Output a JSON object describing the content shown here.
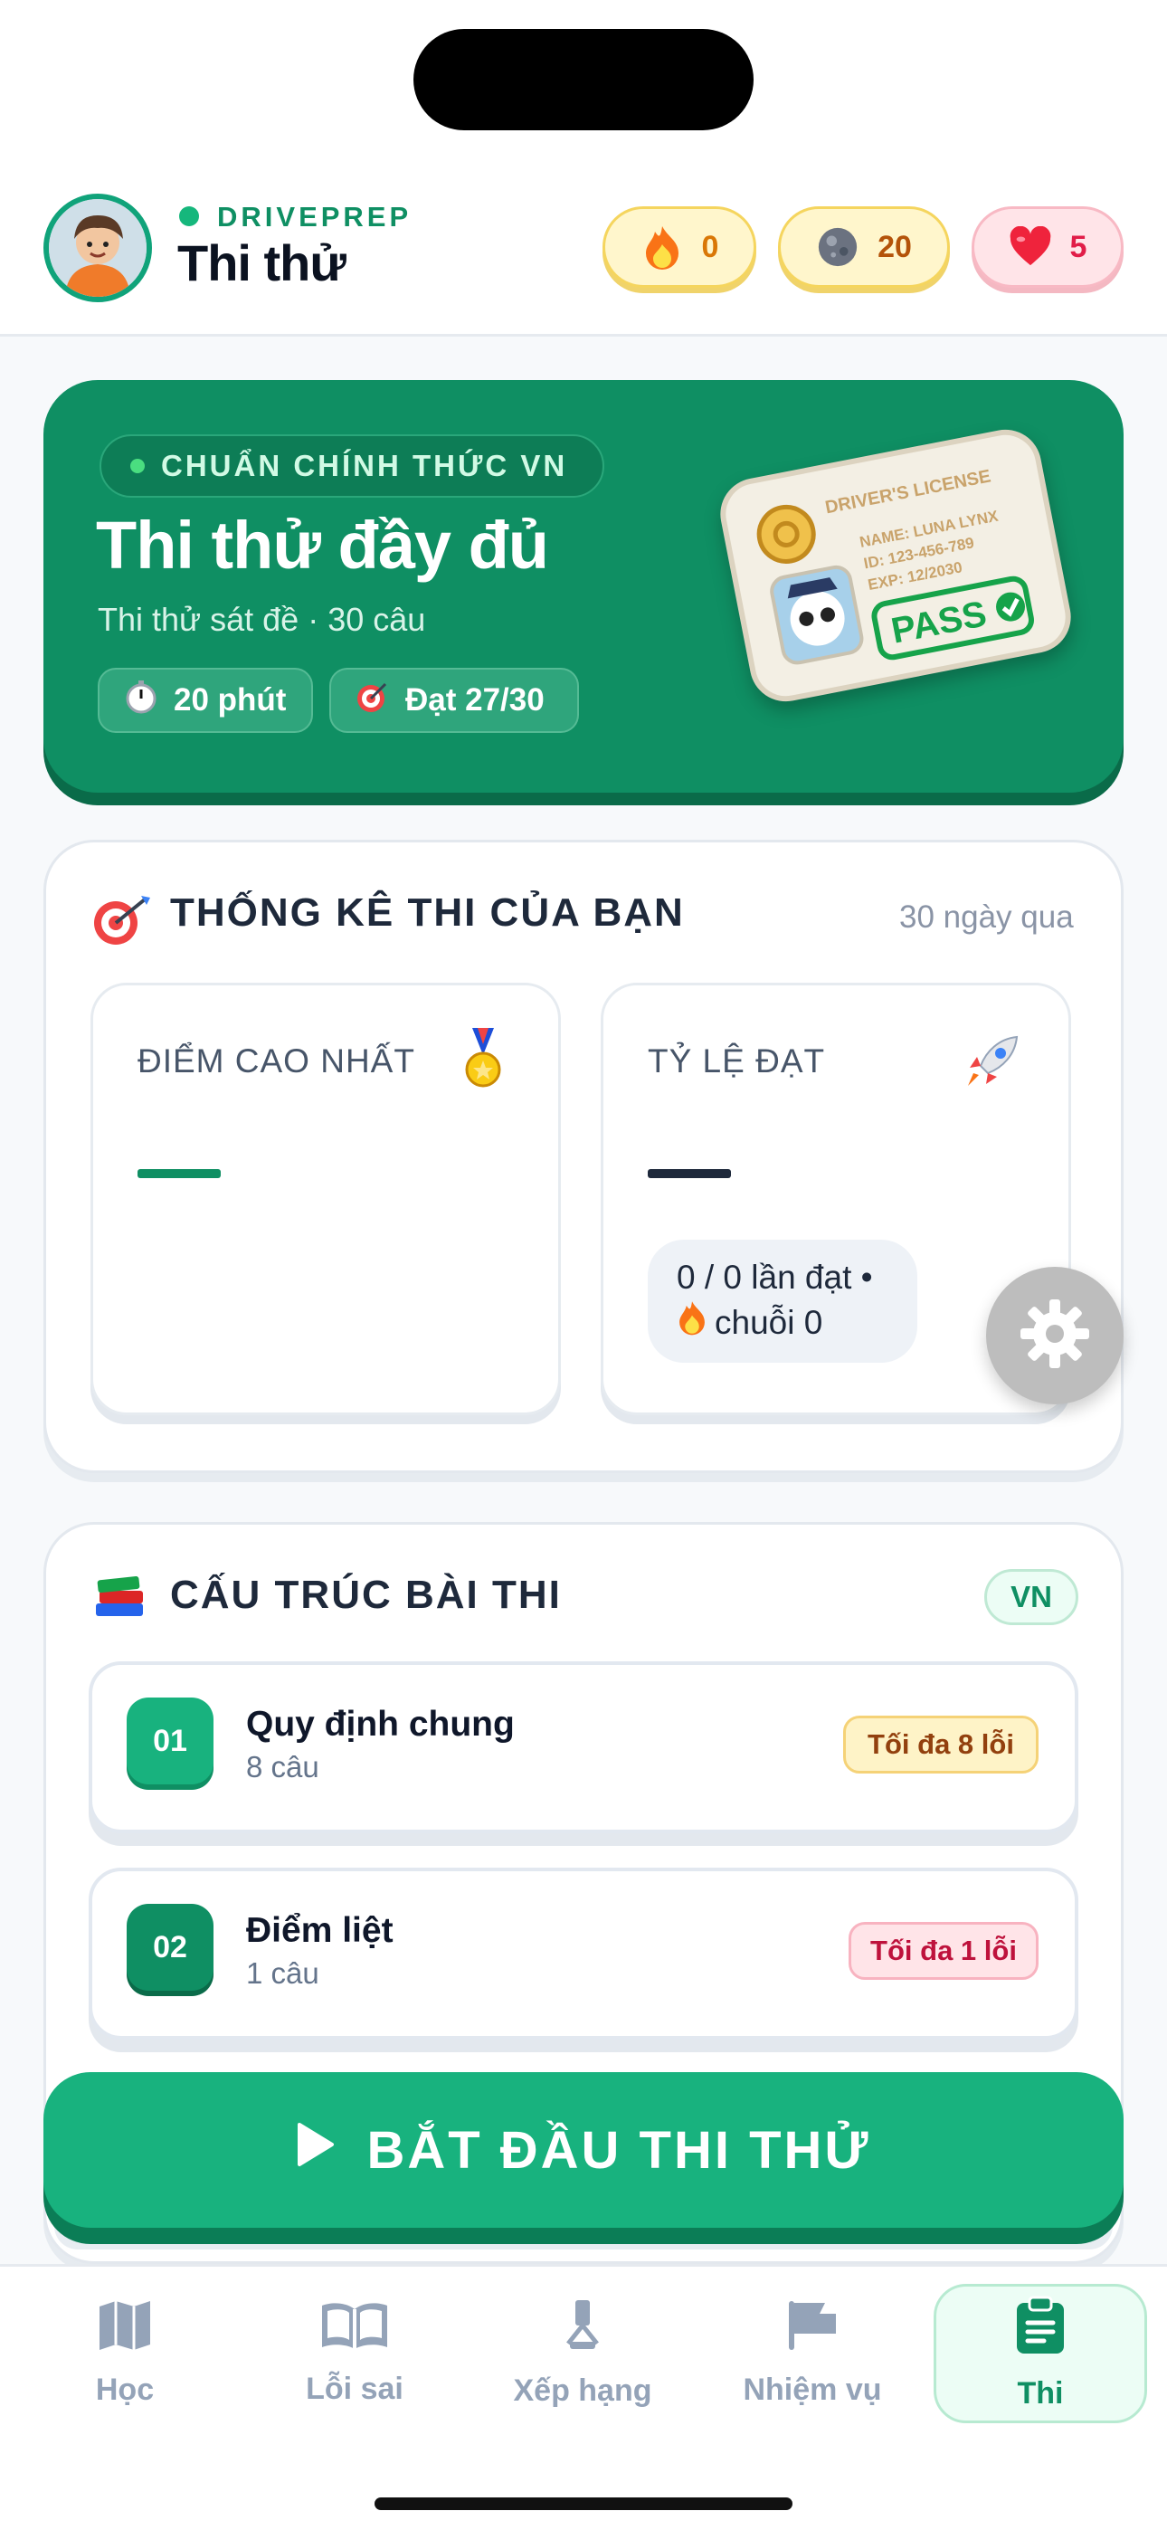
{
  "header": {
    "brand": "DRIVEPREP",
    "title": "Thi thử",
    "stats": {
      "streak": "0",
      "gems": "20",
      "hearts": "5"
    }
  },
  "hero": {
    "tag": "CHUẨN CHÍNH THỨC VN",
    "title": "Thi thử đầy đủ",
    "subtitle": "Thi thử sát đề · 30 câu",
    "time_chip": "20 phút",
    "pass_chip": "Đạt 27/30",
    "license": {
      "heading": "DRIVER'S LICENSE",
      "name": "NAME: LUNA LYNX",
      "id": "ID:  123-456-789",
      "exp": "EXP: 12/2030",
      "stamp": "PASS"
    }
  },
  "stats": {
    "title": "THỐNG KÊ THI CỦA BẠN",
    "period": "30 ngày qua",
    "best_label": "ĐIỂM CAO NHẤT",
    "rate_label": "TỶ LỆ ĐẠT",
    "pass_line1": "0 / 0 lần đạt •",
    "pass_line2": "chuỗi 0"
  },
  "structure": {
    "title": "CẤU TRÚC BÀI THI",
    "badge": "VN",
    "rows": [
      {
        "num": "01",
        "name": "Quy định chung",
        "count": "8 câu",
        "limit": "Tối đa 8 lỗi"
      },
      {
        "num": "02",
        "name": "Điểm liệt",
        "count": "1 câu",
        "limit": "Tối đa 1 lỗi"
      }
    ]
  },
  "start_button": "BẮT ĐẦU THI THỬ",
  "tabs": [
    {
      "label": "Học",
      "icon": "map-icon"
    },
    {
      "label": "Lỗi sai",
      "icon": "book-icon"
    },
    {
      "label": "Xếp hạng",
      "icon": "trophy-icon"
    },
    {
      "label": "Nhiệm vụ",
      "icon": "flag-icon"
    },
    {
      "label": "Thi",
      "icon": "clipboard-icon"
    }
  ],
  "colors": {
    "primary": "#0f8f63",
    "accent": "#18b27e",
    "background": "#f7f9fb"
  }
}
